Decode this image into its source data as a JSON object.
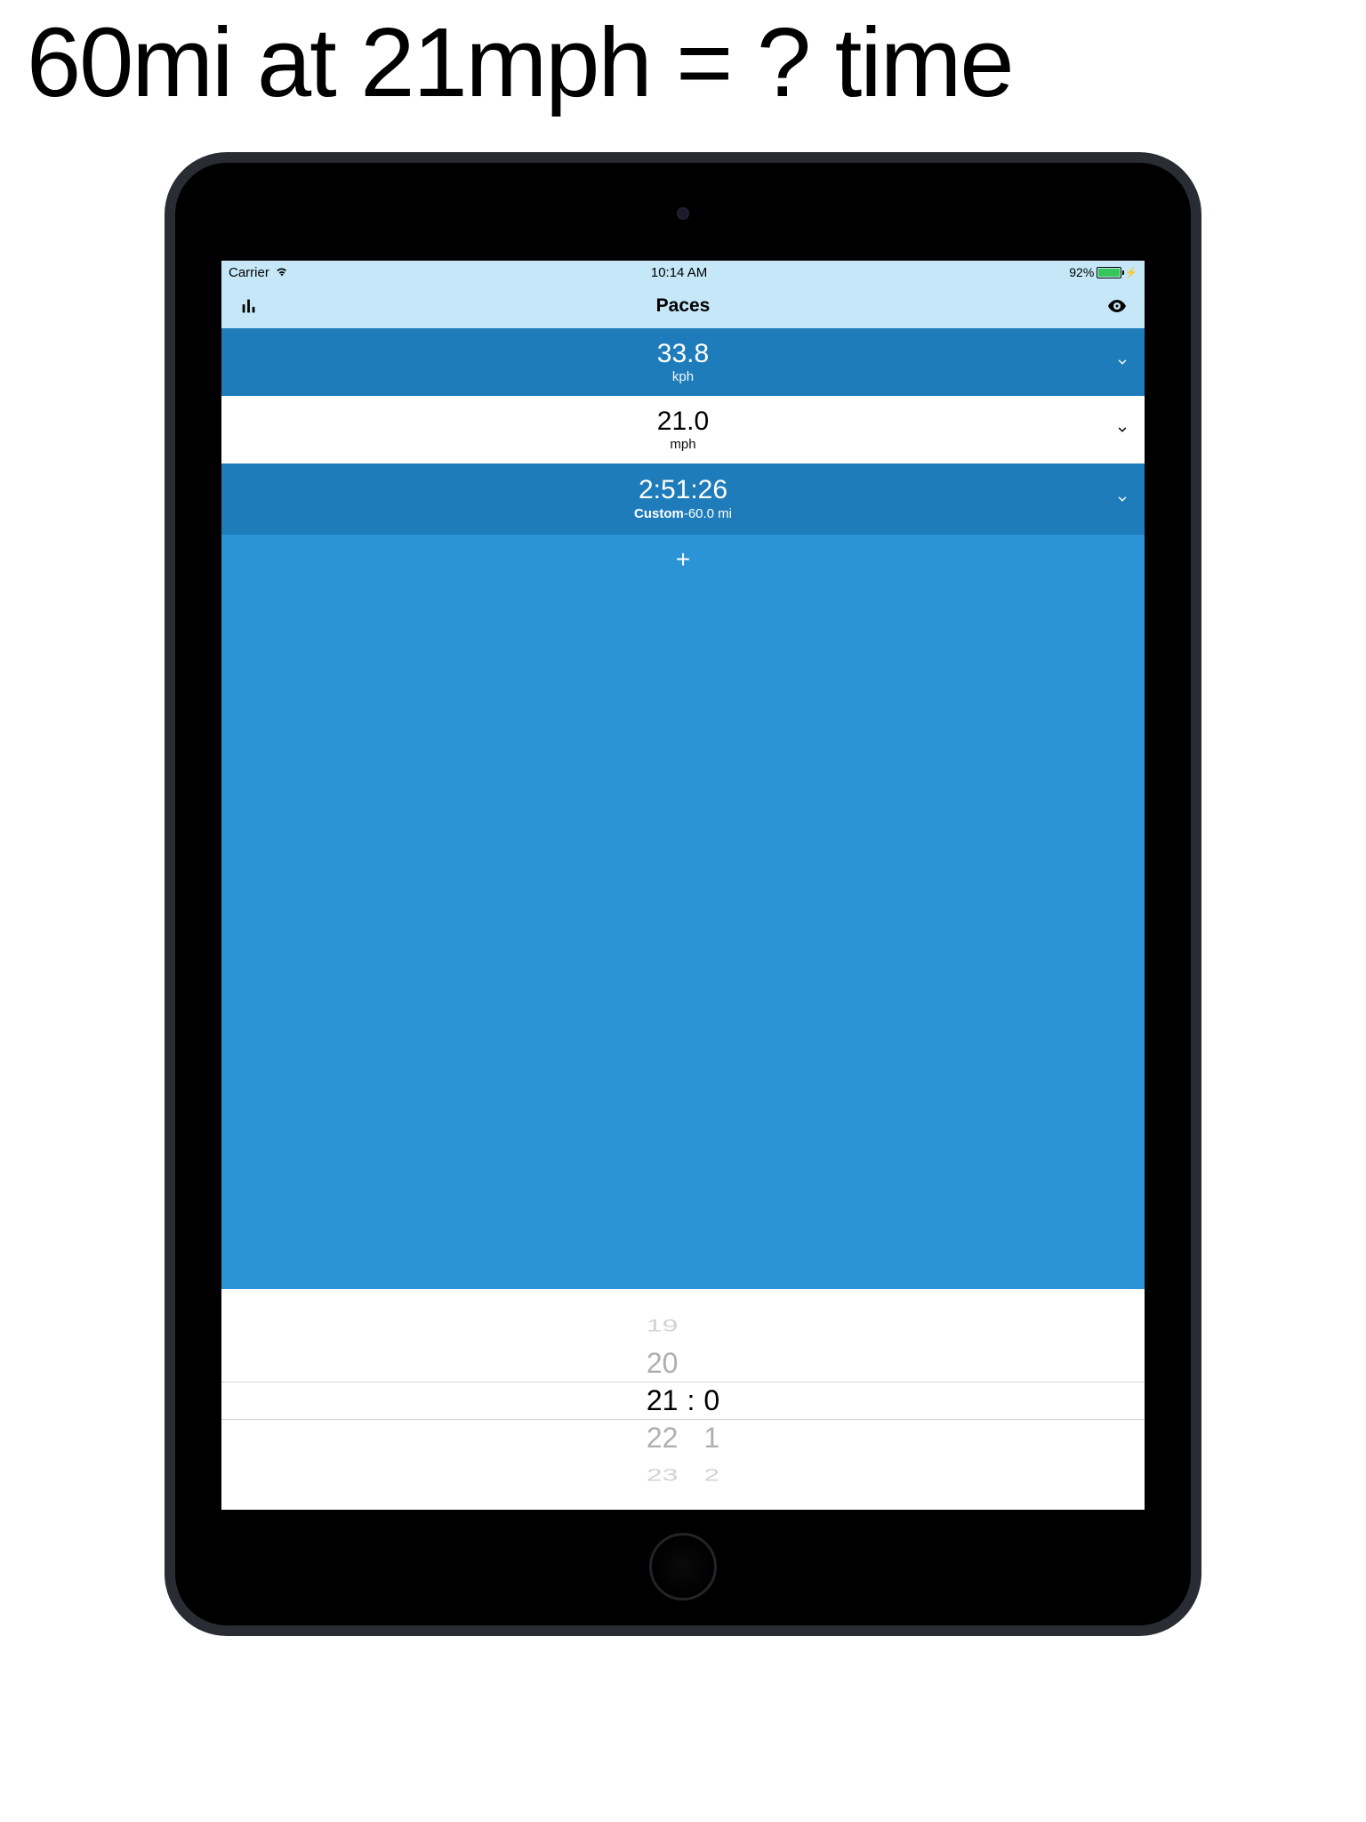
{
  "heading": "60mi at 21mph = ? time",
  "status_bar": {
    "carrier": "Carrier",
    "time": "10:14 AM",
    "battery_pct": "92%"
  },
  "nav": {
    "title": "Paces"
  },
  "rows": {
    "kph": {
      "value": "33.8",
      "unit": "kph"
    },
    "mph": {
      "value": "21.0",
      "unit": "mph"
    },
    "time": {
      "value": "2:51:26",
      "label_bold": "Custom",
      "label_rest": "-60.0 mi"
    }
  },
  "add_label": "+",
  "picker": {
    "left": [
      "19",
      "20",
      "21",
      "22",
      "23"
    ],
    "right": [
      "",
      "",
      "0",
      "1",
      "2"
    ],
    "separator": ":"
  }
}
